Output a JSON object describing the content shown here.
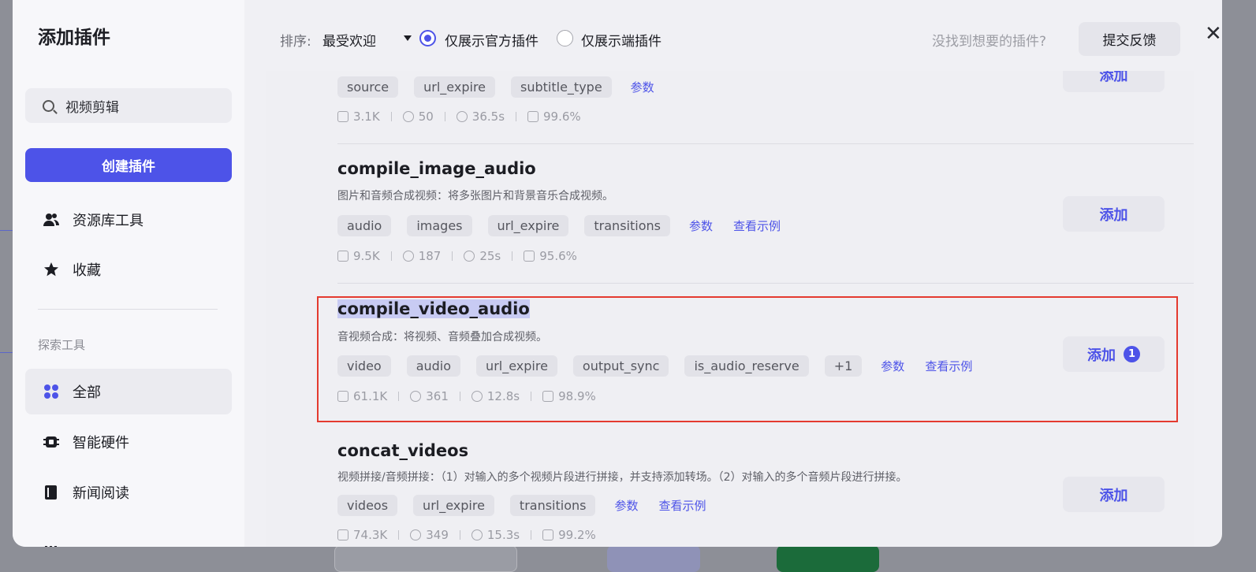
{
  "sidebar": {
    "title": "添加插件",
    "search_value": "视频剪辑",
    "create_label": "创建插件",
    "nav": [
      {
        "label": "资源库工具",
        "icon": "users-icon"
      },
      {
        "label": "收藏",
        "icon": "star-icon"
      }
    ],
    "explore_label": "探索工具",
    "categories": [
      {
        "label": "全部",
        "icon": "grid-icon",
        "active": true
      },
      {
        "label": "智能硬件",
        "icon": "chip-icon"
      },
      {
        "label": "新闻阅读",
        "icon": "book-icon"
      }
    ]
  },
  "header": {
    "sort_label": "排序:",
    "sort_value": "最受欢迎",
    "radio_official": "仅展示官方插件",
    "radio_endside": "仅展示端插件",
    "not_found": "没找到想要的插件?",
    "feedback": "提交反馈",
    "close": "✕"
  },
  "plugins": [
    {
      "title": "",
      "desc": "",
      "tags": [
        "source",
        "url_expire",
        "subtitle_type"
      ],
      "links": [
        "参数"
      ],
      "stats": [
        "3.1K",
        "50",
        "36.5s",
        "99.6%"
      ],
      "add": "添加"
    },
    {
      "title": "compile_image_audio",
      "desc": "图片和音频合成视频：将多张图片和背景音乐合成视频。",
      "tags": [
        "audio",
        "images",
        "url_expire",
        "transitions"
      ],
      "links": [
        "参数",
        "查看示例"
      ],
      "stats": [
        "9.5K",
        "187",
        "25s",
        "95.6%"
      ],
      "add": "添加"
    },
    {
      "title": "compile_video_audio",
      "desc": "音视频合成：将视频、音频叠加合成视频。",
      "tags": [
        "video",
        "audio",
        "url_expire",
        "output_sync",
        "is_audio_reserve",
        "+1"
      ],
      "links": [
        "参数",
        "查看示例"
      ],
      "stats": [
        "61.1K",
        "361",
        "12.8s",
        "98.9%"
      ],
      "add": "添加",
      "badge": "1"
    },
    {
      "title": "concat_videos",
      "desc": "视频拼接/音频拼接：（1）对输入的多个视频片段进行拼接，并支持添加转场。（2）对输入的多个音频片段进行拼接。",
      "tags": [
        "videos",
        "url_expire",
        "transitions"
      ],
      "links": [
        "参数",
        "查看示例"
      ],
      "stats": [
        "74.3K",
        "349",
        "15.3s",
        "99.2%"
      ],
      "add": "添加"
    }
  ]
}
